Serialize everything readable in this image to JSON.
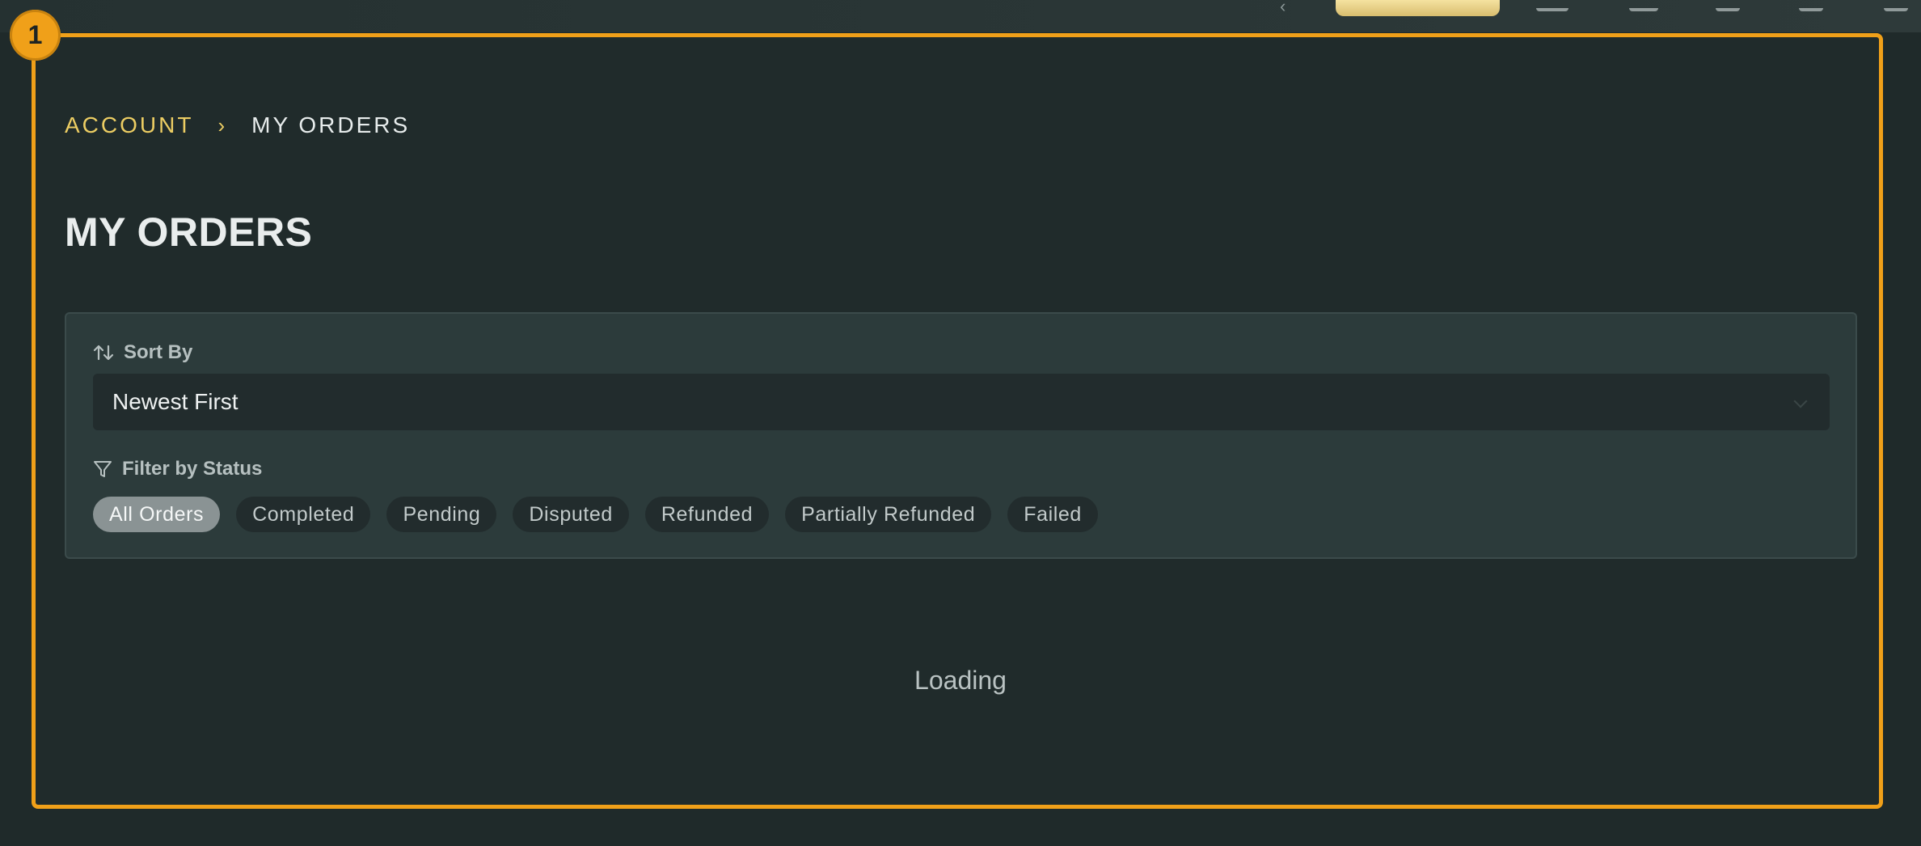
{
  "frame": {
    "badge": "1"
  },
  "breadcrumb": {
    "parent": "ACCOUNT",
    "separator": "›",
    "current": "MY ORDERS"
  },
  "page": {
    "title": "MY ORDERS"
  },
  "sort": {
    "label": "Sort By",
    "icon": "sort-arrows-icon",
    "selected": "Newest First"
  },
  "filter": {
    "label": "Filter by Status",
    "icon": "funnel-icon",
    "chips": [
      {
        "label": "All Orders",
        "active": true
      },
      {
        "label": "Completed",
        "active": false
      },
      {
        "label": "Pending",
        "active": false
      },
      {
        "label": "Disputed",
        "active": false
      },
      {
        "label": "Refunded",
        "active": false
      },
      {
        "label": "Partially Refunded",
        "active": false
      },
      {
        "label": "Failed",
        "active": false
      }
    ]
  },
  "status": {
    "loading": "Loading"
  },
  "colors": {
    "accent": "#f0a019",
    "link": "#eccd63",
    "background": "#202b2b",
    "panel": "#2c3b3b"
  }
}
